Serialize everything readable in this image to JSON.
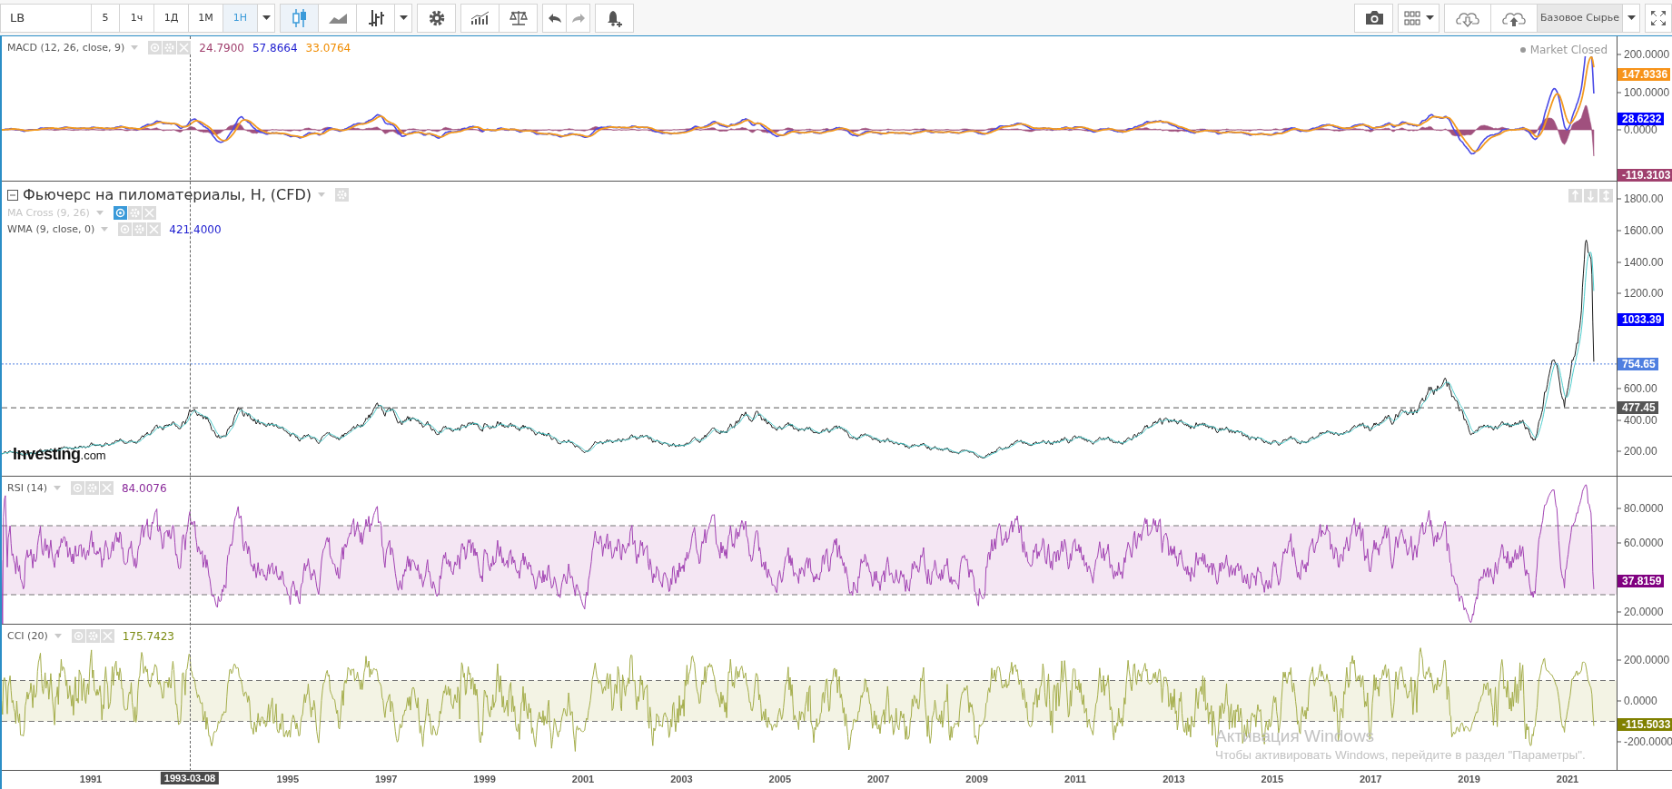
{
  "toolbar": {
    "symbol": "LB",
    "intervals": [
      {
        "label": "5",
        "selected": false
      },
      {
        "label": "1ч",
        "selected": false
      },
      {
        "label": "1Д",
        "selected": false
      },
      {
        "label": "1М",
        "selected": false
      },
      {
        "label": "1Н",
        "selected": true
      }
    ],
    "chart_types": [
      {
        "kind": "candles",
        "selected": true
      },
      {
        "kind": "area",
        "selected": false
      },
      {
        "kind": "bars",
        "selected": false
      }
    ],
    "template_button": "Базовое Сырье"
  },
  "panes": [
    {
      "kind": "macd",
      "title": "MACD (12, 26, close, 9)",
      "values": [
        {
          "text": "24.7900",
          "color": "#a0406e"
        },
        {
          "text": "57.8664",
          "color": "#2020d0"
        },
        {
          "text": "33.0764",
          "color": "#f08c00"
        }
      ],
      "status": "Market Closed",
      "axis_ticks": [
        "200.0000",
        "100.0000",
        "0.0000"
      ],
      "tags": [
        {
          "text": "147.9336",
          "color": "#f7931a"
        },
        {
          "text": "28.6232",
          "color": "#0000ff"
        },
        {
          "text": "-119.3103",
          "color": "#a0406e"
        }
      ]
    },
    {
      "kind": "price",
      "title": "Фьючерс на пиломатериалы, H, (CFD)",
      "indicators": [
        {
          "name": "MA Cross (9, 26)",
          "visible": false
        },
        {
          "name": "WMA (9, close, 0)",
          "visible": true,
          "value": "421.4000"
        }
      ],
      "logo": {
        "name": "Investing",
        "suffix": ".com"
      },
      "axis_ticks": [
        "1800.00",
        "1600.00",
        "1400.00",
        "1200.00",
        "600.00",
        "400.00",
        "200.00"
      ],
      "tags": [
        {
          "text": "1033.39",
          "color": "#0000ff"
        },
        {
          "text": "754.65",
          "color": "#4f7fe0",
          "kind": "dotted"
        },
        {
          "text": "477.45",
          "color": "#555555",
          "kind": "dashed"
        }
      ]
    },
    {
      "kind": "rsi",
      "title": "RSI (14)",
      "values": [
        {
          "text": "84.0076",
          "color": "#8a2a9a"
        }
      ],
      "axis_ticks": [
        "80.0000",
        "60.0000",
        "20.0000"
      ],
      "tags": [
        {
          "text": "37.8159",
          "color": "#800080"
        }
      ]
    },
    {
      "kind": "cci",
      "title": "CCI (20)",
      "values": [
        {
          "text": "175.7423",
          "color": "#7a8a10"
        }
      ],
      "axis_ticks": [
        "200.0000",
        "0.0000",
        "-200.0000"
      ],
      "tags": [
        {
          "text": "-115.5033",
          "color": "#808000"
        }
      ]
    }
  ],
  "time_axis": [
    {
      "label": "1991",
      "kind": "year"
    },
    {
      "label": "1993-03-08",
      "kind": "crosshair"
    },
    {
      "label": "1995",
      "kind": "year"
    },
    {
      "label": "1997",
      "kind": "year"
    },
    {
      "label": "1999",
      "kind": "year"
    },
    {
      "label": "2001",
      "kind": "year"
    },
    {
      "label": "2003",
      "kind": "year"
    },
    {
      "label": "2005",
      "kind": "year"
    },
    {
      "label": "2007",
      "kind": "year"
    },
    {
      "label": "2009",
      "kind": "year"
    },
    {
      "label": "2011",
      "kind": "year"
    },
    {
      "label": "2013",
      "kind": "year"
    },
    {
      "label": "2015",
      "kind": "year"
    },
    {
      "label": "2017",
      "kind": "year"
    },
    {
      "label": "2019",
      "kind": "year"
    },
    {
      "label": "2021",
      "kind": "year"
    }
  ],
  "system_notice": {
    "title": "Активация Windows",
    "text": "Чтобы активировать Windows, перейдите в раздел \"Параметры\"."
  }
}
